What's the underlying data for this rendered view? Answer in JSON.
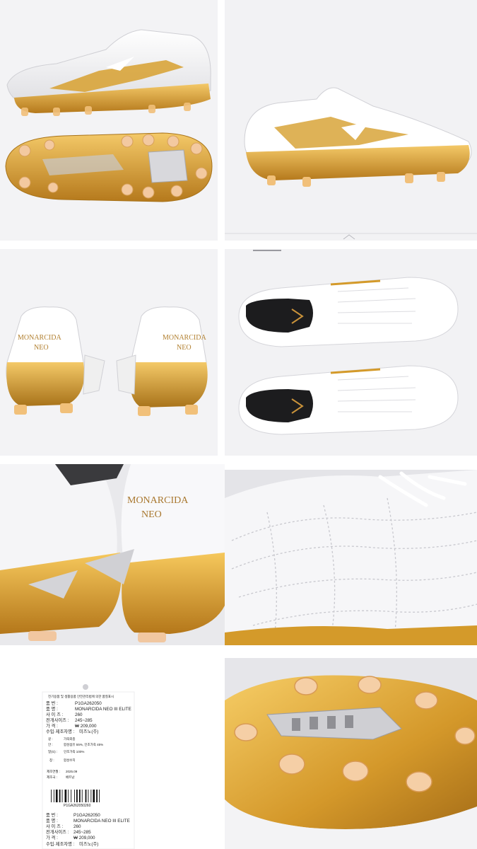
{
  "tiles": {
    "top_left": {
      "name": "side-and-sole-view"
    },
    "top_right": {
      "name": "side-view",
      "logo": "mizuno-runbird-logo"
    },
    "mid_left": {
      "name": "heel-pair-view",
      "heel_text_1": "MONARCIDA",
      "heel_text_2": "NEO"
    },
    "mid_right": {
      "name": "top-down-pair-view",
      "logo": "mizuno-runbird-logo"
    },
    "row3_left": {
      "name": "heel-closeup",
      "heel_text_1": "MONARCIDA",
      "heel_text_2": "NEO"
    },
    "row3_right": {
      "name": "leather-stitching-closeup"
    },
    "bottom_left": {
      "name": "product-label-tag"
    },
    "bottom_right": {
      "name": "stud-sole-closeup"
    }
  },
  "label_tag": {
    "header": "전기용품 및 생활용품 안전관리법에 의한 품질표시",
    "rows_top": [
      {
        "k": "품      번 :",
        "v": "P1GA262050"
      },
      {
        "k": "품      명 :",
        "v": "MONARCIDA NEO III ELITE"
      },
      {
        "k": "사 이 즈 :",
        "v": "260"
      },
      {
        "k": "전개사이즈 :",
        "v": "245~285"
      },
      {
        "k": "가      격 :",
        "v": "₩ 209,000"
      },
      {
        "k": "수입·제조자명 :",
        "v": "미즈노(주)"
      }
    ],
    "material_rows": [
      {
        "k": "겉 :",
        "v": "가죽외층"
      },
      {
        "k": "안 :",
        "v": "합성섬유 55%, 인조가죽 45%"
      },
      {
        "k": "밑(G) :",
        "v": "인조가죽 100%"
      }
    ],
    "origin_row": {
      "k": "창 :",
      "v": "합성수지"
    },
    "date_rows": [
      {
        "k": "제조연월 :",
        "v": "2025.09"
      },
      {
        "k": "제조국 :",
        "v": "베트남"
      }
    ],
    "barcode_text": "P1GA262050260",
    "rows_bottom": [
      {
        "k": "품      번 :",
        "v": "P1GA262050"
      },
      {
        "k": "품      명 :",
        "v": "MONARCIDA NEO III ELITE"
      },
      {
        "k": "사 이 즈 :",
        "v": "260"
      },
      {
        "k": "전개사이즈 :",
        "v": "245~285"
      },
      {
        "k": "가      격 :",
        "v": "₩ 209,000"
      },
      {
        "k": "수입·제조자명 :",
        "v": "미즈노(주)"
      }
    ]
  },
  "colors": {
    "gold": "#d49a2a",
    "gold_light": "#f0c15e",
    "gold_dark": "#a8731a",
    "leather": "#f4f4f6",
    "stitch": "#c9c9cf",
    "bg_light": "#f2f2f4"
  }
}
